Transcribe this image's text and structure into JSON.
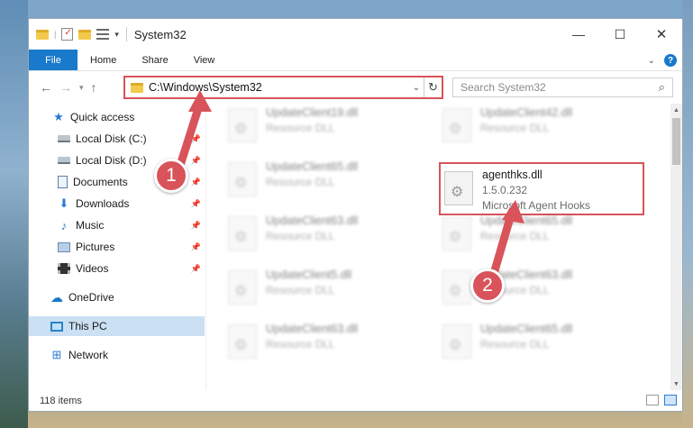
{
  "window": {
    "title": "System32",
    "controls": {
      "minimize": "—",
      "maximize": "☐",
      "close": "✕"
    }
  },
  "ribbon": {
    "tabs": [
      "File",
      "Home",
      "Share",
      "View"
    ],
    "help": "?"
  },
  "address": {
    "path": "C:\\Windows\\System32",
    "search_placeholder": "Search System32"
  },
  "nav_pane": {
    "items": [
      {
        "label": "Quick access",
        "icon": "star-icon",
        "pinned": false
      },
      {
        "label": "Local Disk (C:)",
        "icon": "drive-icon",
        "pinned": true
      },
      {
        "label": "Local Disk (D:)",
        "icon": "drive-icon",
        "pinned": true
      },
      {
        "label": "Documents",
        "icon": "documents-icon",
        "pinned": true
      },
      {
        "label": "Downloads",
        "icon": "downloads-icon",
        "pinned": true
      },
      {
        "label": "Music",
        "icon": "music-icon",
        "pinned": true
      },
      {
        "label": "Pictures",
        "icon": "pictures-icon",
        "pinned": true
      },
      {
        "label": "Videos",
        "icon": "videos-icon",
        "pinned": true
      },
      {
        "label": "OneDrive",
        "icon": "onedrive-icon",
        "pinned": false
      },
      {
        "label": "This PC",
        "icon": "this-pc-icon",
        "pinned": false,
        "selected": true
      },
      {
        "label": "Network",
        "icon": "network-icon",
        "pinned": false
      }
    ]
  },
  "files": {
    "left_column": [
      {
        "name": "UpdateClient19.dll",
        "sub": "Resource DLL"
      },
      {
        "name": "UpdateClient65.dll",
        "sub": "Resource DLL"
      },
      {
        "name": "UpdateClient63.dll",
        "sub": "Resource DLL"
      },
      {
        "name": "UpdateClient5.dll",
        "sub": "Resource DLL"
      },
      {
        "name": "UpdateClient63.dll",
        "sub": "Resource DLL"
      }
    ],
    "right_column": [
      {
        "name": "UpdateClient42.dll",
        "sub": "Resource DLL"
      },
      {
        "name": "agenthks.dll",
        "version": "1.5.0.232",
        "sub": "Microsoft Agent Hooks",
        "highlighted": true
      },
      {
        "name": "UpdateClient65.dll",
        "sub": "Resource DLL"
      },
      {
        "name": "UpdateClient63.dll",
        "sub": "Resource DLL"
      },
      {
        "name": "UpdateClient65.dll",
        "sub": "Resource DLL"
      }
    ]
  },
  "status": {
    "item_count": "118 items"
  },
  "annotations": {
    "badge_1": "1",
    "badge_2": "2",
    "color": "#d9535a"
  }
}
